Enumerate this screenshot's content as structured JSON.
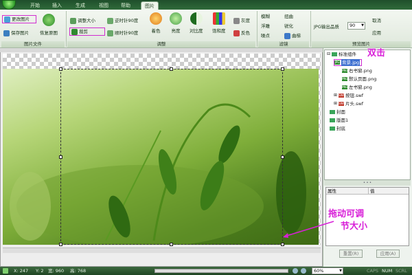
{
  "tabs": [
    "开始",
    "插入",
    "生成",
    "视图",
    "帮助",
    "图片"
  ],
  "ribbon": {
    "file_group": {
      "label": "图片文件",
      "items": [
        "更改图片",
        "保存图片",
        "恢复原图"
      ]
    },
    "adjust_group": {
      "label": "调整",
      "items": [
        "调整大小",
        "逆时针90度",
        "裁剪",
        "顺时针90度",
        "着色",
        "亮度",
        "对比度",
        "饱和度",
        "灰度",
        "反色"
      ]
    },
    "filter_group": {
      "label": "滤镜",
      "items": [
        "模糊",
        "扭曲",
        "浮雕",
        "锐化",
        "噪点",
        "曲梯"
      ]
    },
    "preview_group": {
      "label": "预览图片",
      "jpg_quality_label": "JPG输出品质",
      "jpg_quality_value": "90",
      "cancel": "取消",
      "apply": "应用"
    }
  },
  "tree": {
    "root": "标准组件",
    "items": [
      "背景.jpg",
      "右书窗.png",
      "默认页面.png",
      "左书窗.png",
      "按钮.swf",
      "片头.swf",
      "封面",
      "版面1",
      "封底"
    ]
  },
  "props": {
    "col1": "属性",
    "col2": "值",
    "reset": "重置(R)",
    "apply": "应用(A)"
  },
  "status": {
    "x": "X: 247",
    "y": "Y: 2",
    "w": "宽: 960",
    "h": "高: 768",
    "zoom": "60%",
    "caps": "CAPS",
    "num": "NUM",
    "scrl": "SCRL"
  },
  "annotations": {
    "dblclick": "双击",
    "drag_line1": "拖动可调",
    "drag_line2": "节大小"
  },
  "colors": {
    "accent": "#2e7d32",
    "annotation": "#d81fd8"
  }
}
